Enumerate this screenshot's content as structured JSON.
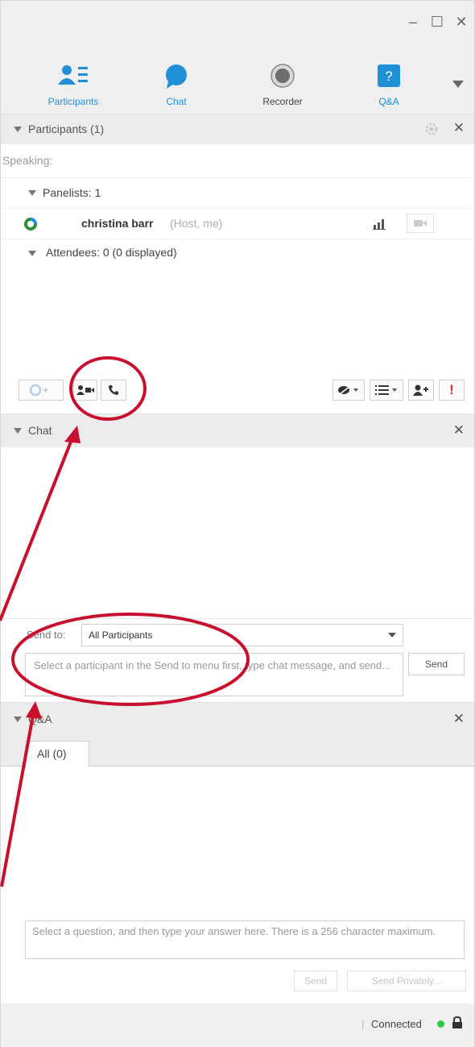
{
  "window": {
    "controls": {
      "minimize": "–",
      "maximize": "☐",
      "close": "✕"
    }
  },
  "nav": {
    "tabs": [
      {
        "label": "Participants",
        "icon": "participants-icon"
      },
      {
        "label": "Chat",
        "icon": "chat-bubble-icon"
      },
      {
        "label": "Recorder",
        "icon": "record-icon"
      },
      {
        "label": "Q&A",
        "icon": "qa-icon",
        "glyph": "?"
      }
    ]
  },
  "participants": {
    "title": "Participants (1)",
    "speaking": "Speaking:",
    "panelists": "Panelists: 1",
    "person": {
      "name": "christina barr",
      "role": "(Host, me)"
    },
    "attendees": "Attendees: 0 (0 displayed)"
  },
  "chat": {
    "title": "Chat",
    "send_to_label": "Send to:",
    "send_to_value": "All Participants",
    "placeholder": "Select a participant in the Send to menu first, type chat message, and send...",
    "send_label": "Send"
  },
  "qa": {
    "title": "Q&A",
    "tab_all": "All (0)",
    "placeholder": "Select a question, and then type your answer here. There is a 256 character maximum.",
    "send_label": "Send",
    "send_private_label": "Send Privately..."
  },
  "status": {
    "text": "Connected",
    "separator": "|"
  },
  "colors": {
    "accent": "#1f8fd6",
    "annotation": "#c8102e",
    "connected": "#2ecc40",
    "alert": "#d62d20"
  }
}
